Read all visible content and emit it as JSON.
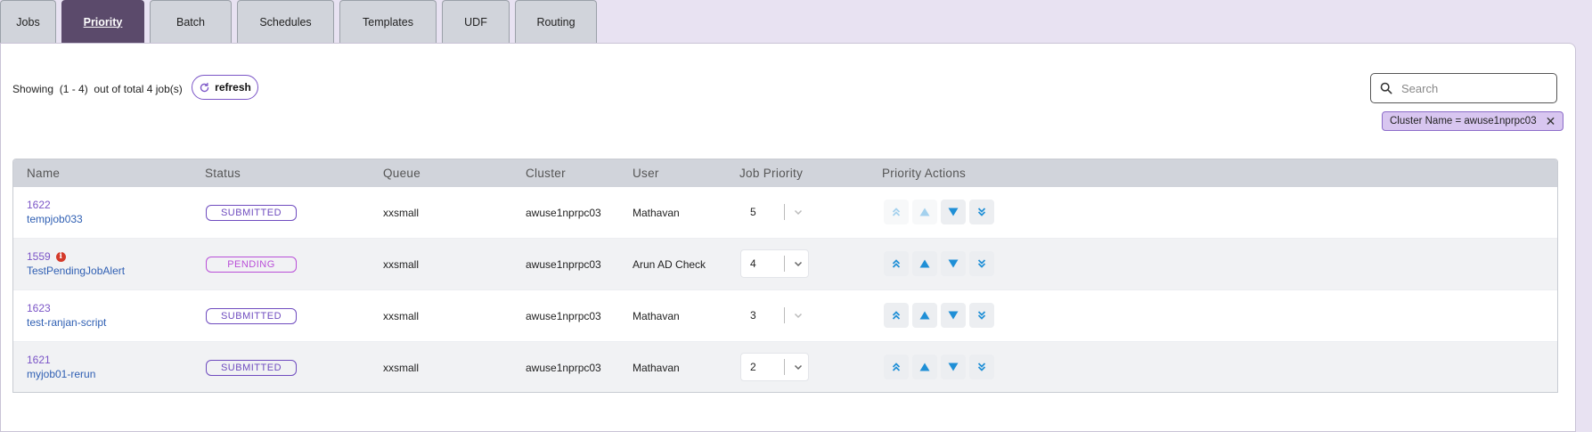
{
  "tabs": [
    {
      "label": "Jobs"
    },
    {
      "label": "Priority"
    },
    {
      "label": "Batch"
    },
    {
      "label": "Schedules"
    },
    {
      "label": "Templates"
    },
    {
      "label": "UDF"
    },
    {
      "label": "Routing"
    }
  ],
  "active_tab": "Priority",
  "summary": {
    "showing_text": "Showing  (1 - 4)  out of total 4 job(s)",
    "refresh_label": "refresh"
  },
  "search": {
    "placeholder": "Search",
    "value": ""
  },
  "filter_chip": {
    "label": "Cluster Name = awuse1nprpc03"
  },
  "table": {
    "columns": [
      "Name",
      "Status",
      "Queue",
      "Cluster",
      "User",
      "Job Priority",
      "Priority Actions"
    ],
    "rows": [
      {
        "id": "1622",
        "name": "tempjob033",
        "status": "SUBMITTED",
        "queue": "xxsmall",
        "cluster": "awuse1nprpc03",
        "user": "Mathavan",
        "priority": "5",
        "has_info": false,
        "priority_editable": false
      },
      {
        "id": "1559",
        "name": "TestPendingJobAlert",
        "status": "PENDING",
        "queue": "xxsmall",
        "cluster": "awuse1nprpc03",
        "user": "Arun AD Check",
        "priority": "4",
        "has_info": true,
        "priority_editable": true
      },
      {
        "id": "1623",
        "name": "test-ranjan-script",
        "status": "SUBMITTED",
        "queue": "xxsmall",
        "cluster": "awuse1nprpc03",
        "user": "Mathavan",
        "priority": "3",
        "has_info": false,
        "priority_editable": false
      },
      {
        "id": "1621",
        "name": "myjob01-rerun",
        "status": "SUBMITTED",
        "queue": "xxsmall",
        "cluster": "awuse1nprpc03",
        "user": "Mathavan",
        "priority": "2",
        "has_info": false,
        "priority_editable": true
      }
    ]
  },
  "colors": {
    "active_tab": "#5b4a6b",
    "accent_purple": "#7b55c7",
    "link_blue": "#2f5fb3",
    "arrow_blue": "#1f8fd6",
    "info_red": "#d43a2a"
  },
  "icons": {
    "refresh": "refresh-icon",
    "search": "search-icon",
    "chip_close": "close-icon",
    "info": "info-icon",
    "move_top": "double-chevron-up-icon",
    "move_up": "triangle-up-icon",
    "move_down": "triangle-down-icon",
    "move_bottom": "double-chevron-down-icon",
    "dropdown": "chevron-down-icon"
  }
}
